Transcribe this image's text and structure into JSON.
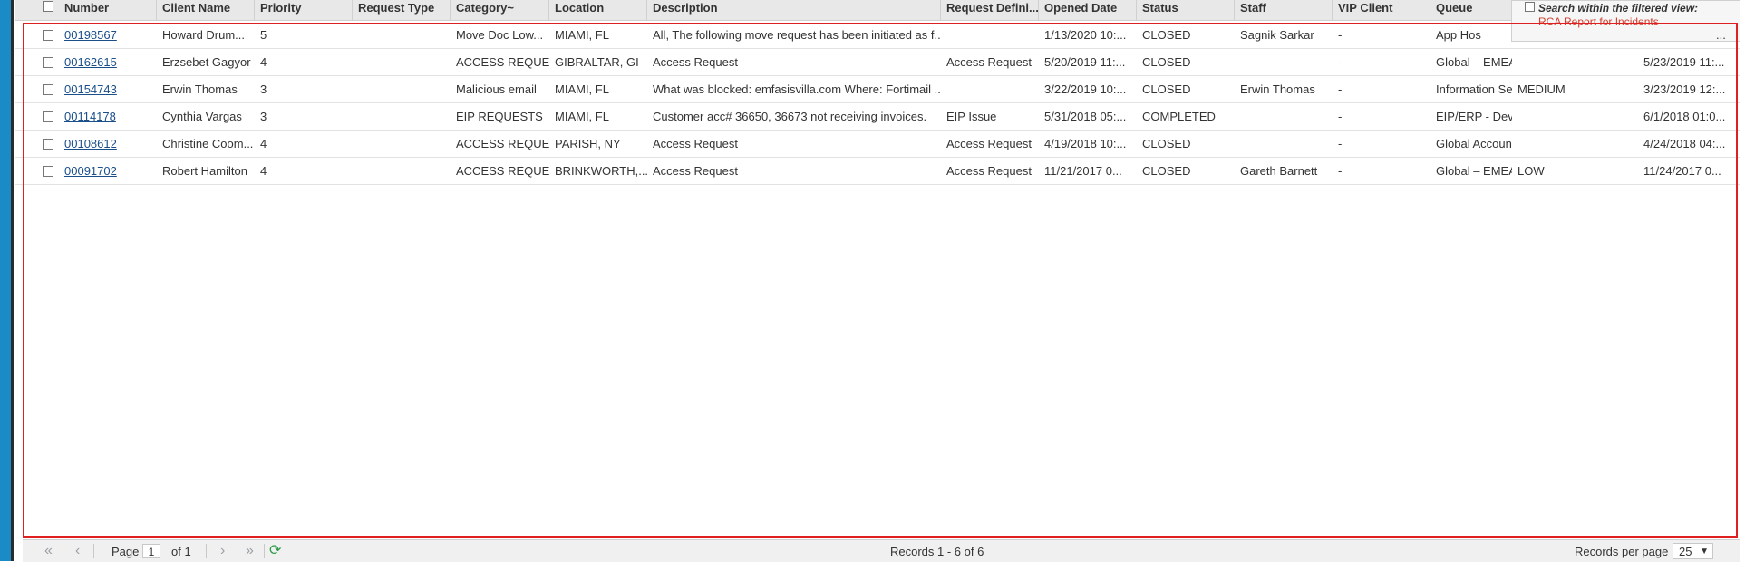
{
  "columns": [
    "Number",
    "Client Name",
    "Priority",
    "Request Type",
    "Category~",
    "Location",
    "Description",
    "Request Defini...",
    "Opened Date",
    "Status",
    "Staff",
    "VIP Client",
    "Queue"
  ],
  "search": {
    "label": "Search within the filtered view:",
    "sublabel": "RCA Report for Incidents"
  },
  "rows": [
    {
      "number": "00198567",
      "client": "Howard Drum...",
      "priority": "5",
      "request_type": "",
      "category": "Move Doc Low...",
      "location": "MIAMI, FL",
      "description": "All, The following move request has been initiated as f...",
      "request_def": "",
      "opened": "1/13/2020 10:...",
      "status": "CLOSED",
      "staff": "Sagnik Sarkar",
      "vip": "-",
      "queue": "App Hos",
      "extra1": "",
      "extra2": "...",
      "date2": ""
    },
    {
      "number": "00162615",
      "client": "Erzsebet Gagyor",
      "priority": "4",
      "request_type": "",
      "category": "ACCESS REQUE...",
      "location": "GIBRALTAR, GI",
      "description": "Access Request",
      "request_def": "Access Request",
      "opened": "5/20/2019 11:...",
      "status": "CLOSED",
      "staff": "",
      "vip": "-",
      "queue": "Global – EMEA ...",
      "extra1": "",
      "extra2": "",
      "date2": "5/23/2019 11:..."
    },
    {
      "number": "00154743",
      "client": "Erwin Thomas",
      "priority": "3",
      "request_type": "",
      "category": "Malicious email",
      "location": "MIAMI, FL",
      "description": "What was blocked: emfasisvilla.com Where: Fortimail ...",
      "request_def": "",
      "opened": "3/22/2019 10:...",
      "status": "CLOSED",
      "staff": "Erwin Thomas",
      "vip": "-",
      "queue": "Information Se...",
      "extra1": "MEDIUM",
      "extra2": "",
      "date2": "3/23/2019 12:..."
    },
    {
      "number": "00114178",
      "client": "Cynthia Vargas",
      "priority": "3",
      "request_type": "",
      "category": "EIP REQUESTS",
      "location": "MIAMI, FL",
      "description": "Customer acc# 36650, 36673 not receiving invoices.",
      "request_def": "EIP Issue",
      "opened": "5/31/2018 05:...",
      "status": "COMPLETED",
      "staff": "",
      "vip": "-",
      "queue": "EIP/ERP - Deve...",
      "extra1": "",
      "extra2": "",
      "date2": "6/1/2018 01:0..."
    },
    {
      "number": "00108612",
      "client": "Christine Coom...",
      "priority": "4",
      "request_type": "",
      "category": "ACCESS REQUE...",
      "location": "PARISH, NY",
      "description": "Access Request",
      "request_def": "Access Request",
      "opened": "4/19/2018 10:...",
      "status": "CLOSED",
      "staff": "",
      "vip": "-",
      "queue": "Global Account...",
      "extra1": "",
      "extra2": "",
      "date2": "4/24/2018 04:..."
    },
    {
      "number": "00091702",
      "client": "Robert Hamilton",
      "priority": "4",
      "request_type": "",
      "category": "ACCESS REQUE...",
      "location": "BRINKWORTH,...",
      "description": "Access Request",
      "request_def": "Access Request",
      "opened": "11/21/2017 0...",
      "status": "CLOSED",
      "staff": "Gareth Barnett",
      "vip": "-",
      "queue": "Global – EMEA ...",
      "extra1": "LOW",
      "extra2": "",
      "date2": "11/24/2017 0..."
    }
  ],
  "footer": {
    "page_label": "Page",
    "page_value": "1",
    "of_label": "of 1",
    "records_text": "Records 1 - 6 of 6",
    "rpp_label": "Records per page",
    "rpp_value": "25"
  }
}
